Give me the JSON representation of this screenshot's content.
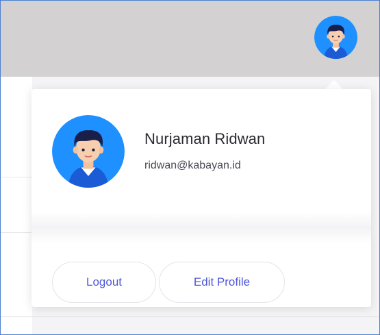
{
  "header": {
    "avatar_icon": "user-avatar-icon"
  },
  "profile_menu": {
    "avatar_icon": "user-avatar-icon",
    "name": "Nurjaman Ridwan",
    "email": "ridwan@kabayan.id",
    "logout_label": "Logout",
    "edit_profile_label": "Edit Profile"
  },
  "colors": {
    "topbar": "#d3d1d2",
    "avatar_background": "#1e90ff",
    "button_text": "#4e56d8",
    "frame_border": "#4a7fd0"
  }
}
